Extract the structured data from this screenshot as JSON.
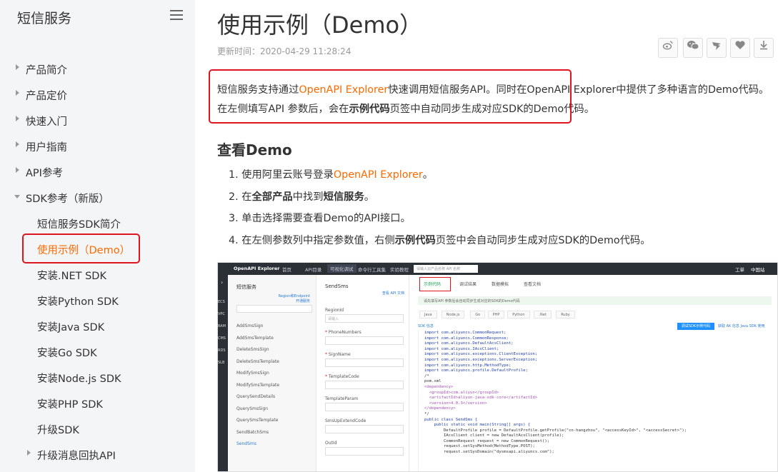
{
  "sidebar": {
    "title": "短信服务",
    "items": [
      {
        "label": "产品简介",
        "arrow": "right",
        "level": 1
      },
      {
        "label": "产品定价",
        "arrow": "right",
        "level": 1
      },
      {
        "label": "快速入门",
        "arrow": "right",
        "level": 1
      },
      {
        "label": "用户指南",
        "arrow": "right",
        "level": 1
      },
      {
        "label": "API参考",
        "arrow": "right",
        "level": 1
      },
      {
        "label": "SDK参考（新版）",
        "arrow": "down",
        "level": 1
      },
      {
        "label": "短信服务SDK简介",
        "arrow": "",
        "level": 2
      },
      {
        "label": "使用示例（Demo）",
        "arrow": "",
        "level": 2,
        "active": true
      },
      {
        "label": "安装.NET SDK",
        "arrow": "",
        "level": 2
      },
      {
        "label": "安装Python SDK",
        "arrow": "",
        "level": 2
      },
      {
        "label": "安装Java SDK",
        "arrow": "",
        "level": 2
      },
      {
        "label": "安装Go SDK",
        "arrow": "",
        "level": 2
      },
      {
        "label": "安装Node.js SDK",
        "arrow": "",
        "level": 2
      },
      {
        "label": "安装PHP SDK",
        "arrow": "",
        "level": 2
      },
      {
        "label": "升级SDK",
        "arrow": "",
        "level": 2
      },
      {
        "label": "升级消息回执API",
        "arrow": "right",
        "level": 2
      }
    ]
  },
  "page": {
    "title": "使用示例（Demo）",
    "updated": "更新时间：2020-04-29 11:28:24",
    "share_icons": [
      "weibo-icon",
      "wechat-icon",
      "dingtalk-icon",
      "like-icon",
      "download-icon"
    ],
    "intro": {
      "p1": "短信服务支持通过",
      "link": "OpenAPI Explorer",
      "p2": "快速调用短信服务API。同时在OpenAPI Explorer中提供了多种语言的Demo代码。在左侧填写API 参数后，会在",
      "bold": "示例代码",
      "p3": "页签中自动同步生成对应SDK的Demo代码。"
    },
    "section_title": "查看Demo",
    "steps": {
      "s1a": "1. 使用阿里云账号登录",
      "s1link": "OpenAPI Explorer",
      "s1b": "。",
      "s2a": "2. 在",
      "s2b1": "全部产品",
      "s2c": "中找到",
      "s2b2": "短信服务",
      "s2d": "。",
      "s3": "3. 单击选择需要查看Demo的API接口。",
      "s4a": "4. 在左侧参数列中指定参数值，右侧",
      "s4b": "示例代码",
      "s4c": "页签中会自动同步生成对应SDK的Demo代码。"
    }
  },
  "screenshot": {
    "topbar": {
      "brand": "OpenAPI Explorer",
      "nav": [
        "首页",
        "API目录",
        "可视化调试",
        "命令行工具集",
        "实验教程"
      ],
      "search_placeholder": "请输入云产品名称 API 名称",
      "right": [
        "工单",
        "中国站"
      ]
    },
    "rail": [
      "ECS",
      "VPC",
      "RAM",
      "CMS",
      "RDS",
      "SLB"
    ],
    "col1": {
      "title": "短信服务",
      "region_link1": "Region和Endpoint",
      "region_link2": "开通服务",
      "apis": [
        "AddSmsSign",
        "AddSmsTemplate",
        "DeleteSmsSign",
        "DeleteSmsTemplate",
        "ModifySmsSign",
        "ModifySmsTemplate",
        "QuerySendDetails",
        "QuerySmsSign",
        "QuerySmsTemplate",
        "SendBatchSms",
        "SendSms"
      ]
    },
    "col2": {
      "title": "SendSms",
      "doc_link": "查看 API 文档",
      "params": [
        {
          "label": "RegionId",
          "required": false,
          "placeholder": "请输入"
        },
        {
          "label": "PhoneNumbers",
          "required": true,
          "placeholder": ""
        },
        {
          "label": "SignName",
          "required": true,
          "placeholder": ""
        },
        {
          "label": "TemplateCode",
          "required": true,
          "placeholder": ""
        },
        {
          "label": "TemplateParam",
          "required": false,
          "placeholder": ""
        },
        {
          "label": "SmsUpExtendCode",
          "required": false,
          "placeholder": ""
        },
        {
          "label": "OutId",
          "required": false,
          "placeholder": ""
        }
      ]
    },
    "col3": {
      "tabs": [
        "示例代码",
        "调试结果",
        "数据模拟",
        "查看文档"
      ],
      "hint": "请先填写API 参数后会自动同步生成对应的SDK的Demo代码",
      "langs": [
        "Java",
        "Node.js",
        "Go",
        "PHP",
        "Python",
        ".Net",
        "Ruby"
      ],
      "sdk_label": "SDK 信息",
      "run_button": "调试SDK示例代码",
      "right_links": "获取 AK 信息    Java SDK 使用",
      "code": [
        "import com.aliyuncs.CommonRequest;",
        "import com.aliyuncs.CommonResponse;",
        "import com.aliyuncs.DefaultAcsClient;",
        "import com.aliyuncs.IAcsClient;",
        "import com.aliyuncs.exceptions.ClientException;",
        "import com.aliyuncs.exceptions.ServerException;",
        "import com.aliyuncs.http.MethodType;",
        "import com.aliyuncs.profile.DefaultProfile;",
        "/*",
        "pom.xml",
        "<dependency>",
        "  <groupId>com.aliyun</groupId>",
        "  <artifactId>aliyun-java-sdk-core</artifactId>",
        "  <version>4.0.3</version>",
        "</dependency>",
        "*/",
        "public class SendSms {",
        "    public static void main(String[] args) {",
        "        DefaultProfile profile = DefaultProfile.getProfile(\"cn-hangzhou\", \"<accessKeyId>\", \"<accessSecret>\");",
        "        IAcsClient client = new DefaultAcsClient(profile);",
        "",
        "        CommonRequest request = new CommonRequest();",
        "        request.setSysMethod(MethodType.POST);",
        "        request.setSysDomain(\"dysmsapi.aliyuncs.com\");"
      ]
    }
  }
}
